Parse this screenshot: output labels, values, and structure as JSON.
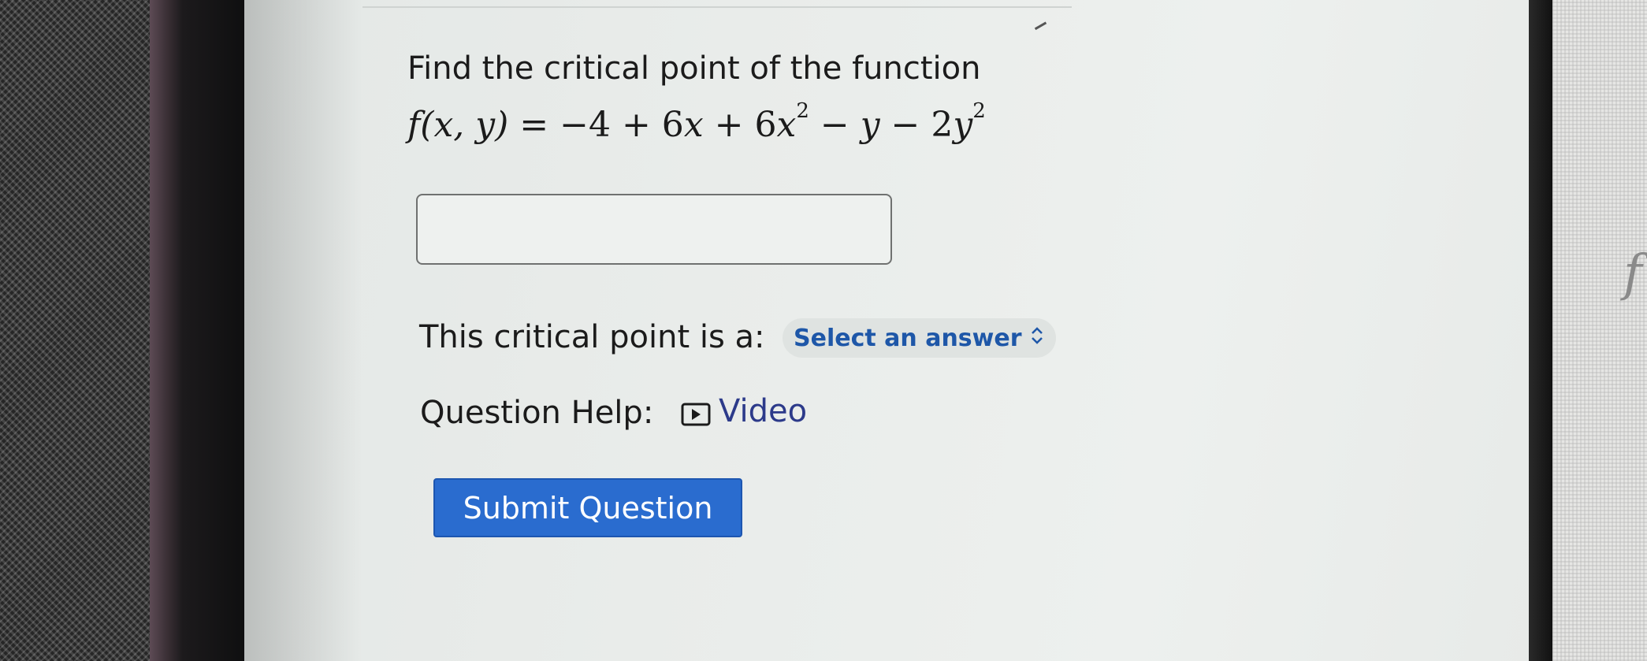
{
  "question": {
    "prompt": "Find the critical point of the function",
    "formula": {
      "lhs": "f(x, y)",
      "equals": " = −4 + 6",
      "x1": "x",
      "plus": " + 6",
      "x2": "x",
      "exp1": "2",
      "minus_y": " − ",
      "y1": "y",
      "minus_2": " − 2",
      "y2": "y",
      "exp2": "2"
    },
    "answer_value": "",
    "critical_label": "This critical point is a:",
    "select": {
      "selected": "Select an answer"
    },
    "help_label": "Question Help:",
    "video_label": "Video",
    "submit_label": "Submit Question"
  },
  "icons": {
    "video": "video-play-icon",
    "select": "up-down-chevron-icon"
  },
  "colors": {
    "link": "#2c3a8a",
    "select_text": "#1e57a8",
    "submit_bg": "#2a6ccf"
  }
}
